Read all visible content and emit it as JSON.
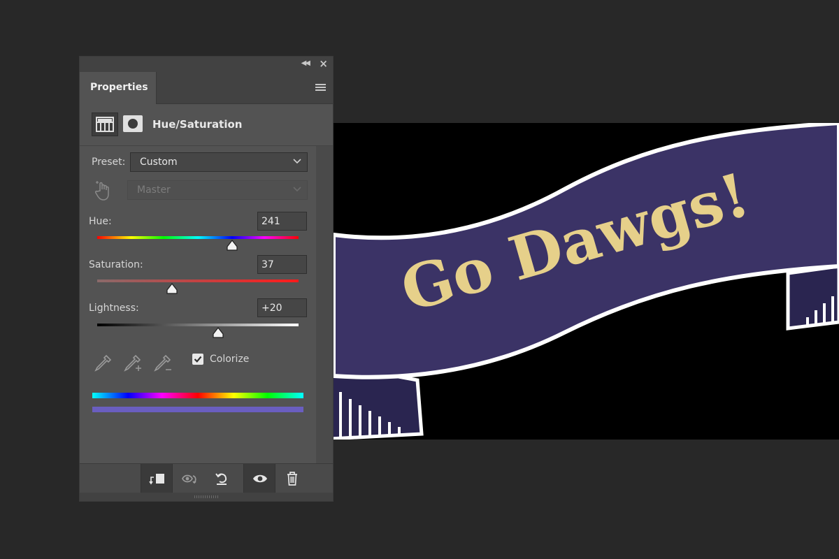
{
  "panel": {
    "tab_label": "Properties",
    "adjustment_title": "Hue/Saturation",
    "preset_label": "Preset:",
    "preset_value": "Custom",
    "channel_value": "Master",
    "hue": {
      "label": "Hue:",
      "value": "241",
      "level": 0.67
    },
    "saturation": {
      "label": "Saturation:",
      "value": "37",
      "level": 0.37
    },
    "lightness": {
      "label": "Lightness:",
      "value": "+20",
      "level": 0.6
    },
    "colorize_label": "Colorize",
    "colorize_checked": true,
    "result_color": "#6a5ec0"
  },
  "canvas": {
    "banner_text": "Go Dawgs!",
    "banner_color": "#3b3366",
    "text_color": "#e6d08a",
    "outline_color": "#ffffff"
  },
  "icons": {
    "collapse": "double-chevron-left-icon",
    "close": "close-icon",
    "menu": "panel-menu-icon",
    "footer": [
      "clip-to-layer-icon",
      "view-previous-state-icon",
      "reset-icon",
      "visibility-icon",
      "trash-icon"
    ]
  }
}
